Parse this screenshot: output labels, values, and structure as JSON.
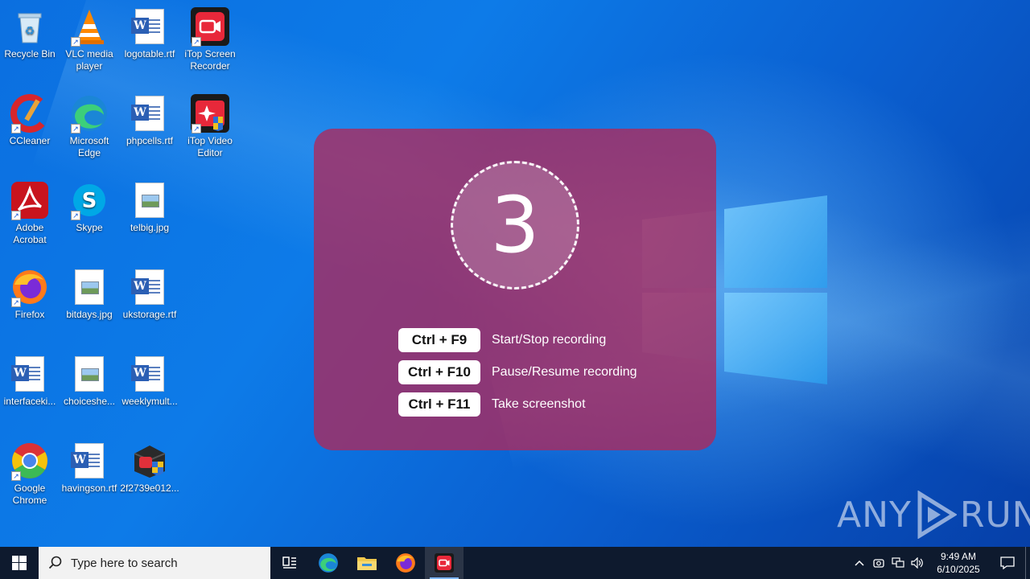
{
  "desktop": {
    "icons": [
      {
        "label": "Recycle Bin",
        "icon": "recycle-bin-icon"
      },
      {
        "label": "VLC media player",
        "icon": "vlc-icon"
      },
      {
        "label": "logotable.rtf",
        "icon": "word-document-icon"
      },
      {
        "label": "iTop Screen Recorder",
        "icon": "itop-screen-recorder-icon"
      },
      {
        "label": "CCleaner",
        "icon": "ccleaner-icon"
      },
      {
        "label": "Microsoft Edge",
        "icon": "edge-icon"
      },
      {
        "label": "phpcells.rtf",
        "icon": "word-document-icon"
      },
      {
        "label": "iTop Video Editor",
        "icon": "itop-video-editor-icon"
      },
      {
        "label": "Adobe Acrobat",
        "icon": "acrobat-icon"
      },
      {
        "label": "Skype",
        "icon": "skype-icon"
      },
      {
        "label": "telbig.jpg",
        "icon": "image-file-icon"
      },
      {
        "label": "Firefox",
        "icon": "firefox-icon"
      },
      {
        "label": "bitdays.jpg",
        "icon": "image-file-icon"
      },
      {
        "label": "ukstorage.rtf",
        "icon": "word-document-icon"
      },
      {
        "label": "interfaceki...",
        "icon": "word-document-icon"
      },
      {
        "label": "choiceshe...",
        "icon": "image-file-icon"
      },
      {
        "label": "weeklymult...",
        "icon": "word-document-icon"
      },
      {
        "label": "Google Chrome",
        "icon": "chrome-icon"
      },
      {
        "label": "havingson.rtf",
        "icon": "word-document-icon"
      },
      {
        "label": "2f2739e012...",
        "icon": "installer-icon"
      }
    ]
  },
  "recorder_overlay": {
    "countdown": "3",
    "hotkeys": [
      {
        "key": "Ctrl + F9",
        "action": "Start/Stop recording"
      },
      {
        "key": "Ctrl + F10",
        "action": "Pause/Resume recording"
      },
      {
        "key": "Ctrl + F11",
        "action": "Take screenshot"
      }
    ],
    "background_color": "#b0285a"
  },
  "watermark": {
    "left": "ANY",
    "right": "RUN"
  },
  "taskbar": {
    "search_placeholder": "Type here to search",
    "pinned": [
      "task-view-icon",
      "edge-icon",
      "file-explorer-icon",
      "firefox-icon",
      "itop-screen-recorder-icon"
    ],
    "clock": {
      "time": "9:49 AM",
      "date": "6/10/2025"
    }
  }
}
